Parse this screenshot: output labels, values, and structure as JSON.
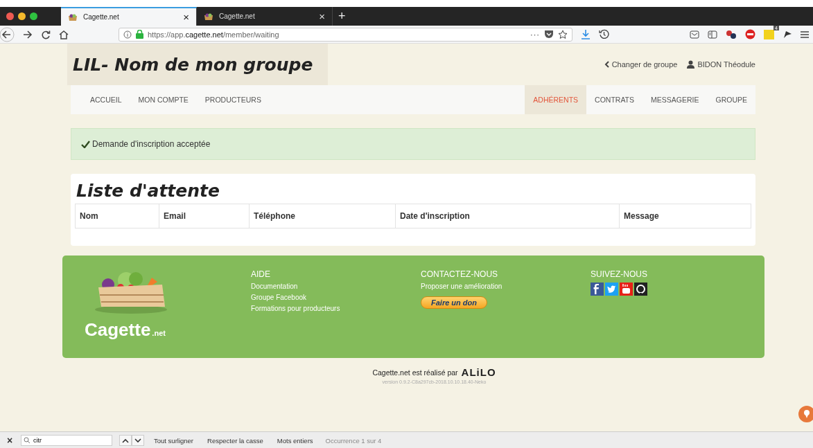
{
  "browser": {
    "tabs": [
      {
        "title": "Cagette.net",
        "selected": true,
        "close": "×"
      },
      {
        "title": "Cagette.net",
        "selected": false,
        "close": "×"
      }
    ],
    "new_tab": "+",
    "url_prefix": "https://",
    "url": "app.**cagette.net**/member/waiting",
    "page_actions": "···",
    "extension_badge": "4"
  },
  "header": {
    "group_title": "LIL- Nom de mon groupe",
    "change_group": "Changer de groupe",
    "user": "BIDON Théodule"
  },
  "nav": {
    "left": [
      {
        "label": "ACCUEIL",
        "selected": false
      },
      {
        "label": "MON COMPTE",
        "selected": false
      },
      {
        "label": "PRODUCTEURS",
        "selected": false
      }
    ],
    "right": [
      {
        "label": "ADHÉRENTS",
        "selected": true
      },
      {
        "label": "CONTRATS",
        "selected": false
      },
      {
        "label": "MESSAGERIE",
        "selected": false
      },
      {
        "label": "GROUPE",
        "selected": false
      }
    ]
  },
  "alert": {
    "message": "Demande d'inscription acceptée"
  },
  "waiting_list": {
    "title": "Liste d'attente",
    "columns": [
      "Nom",
      "Email",
      "Téléphone",
      "Date d'inscription",
      "Message"
    ]
  },
  "footer": {
    "logo_text": "Cagette",
    "logo_suffix": ".net",
    "columns": [
      {
        "heading": "AIDE",
        "links": [
          "Documentation",
          "Groupe Facebook",
          "Formations pour producteurs"
        ]
      },
      {
        "heading": "CONTACTEZ-NOUS",
        "links": [
          "Proposer une amélioration"
        ],
        "button": "Faire un don"
      },
      {
        "heading": "SUIVEZ-NOUS",
        "social": [
          {
            "kind": "facebook"
          },
          {
            "kind": "twitter"
          },
          {
            "kind": "youtube"
          },
          {
            "kind": "github"
          }
        ]
      }
    ]
  },
  "credits": {
    "text": "Cagette.net est réalisé par",
    "brand": "ALiLO",
    "version": "version 0.9.2-C8a297cb-2018.10.10.18.40-Neko"
  },
  "find_bar": {
    "close": "×",
    "query": "citr",
    "options": [
      "Tout surligner",
      "Respecter la casse",
      "Mots entiers"
    ],
    "status": "Occurrence 1 sur 4"
  }
}
